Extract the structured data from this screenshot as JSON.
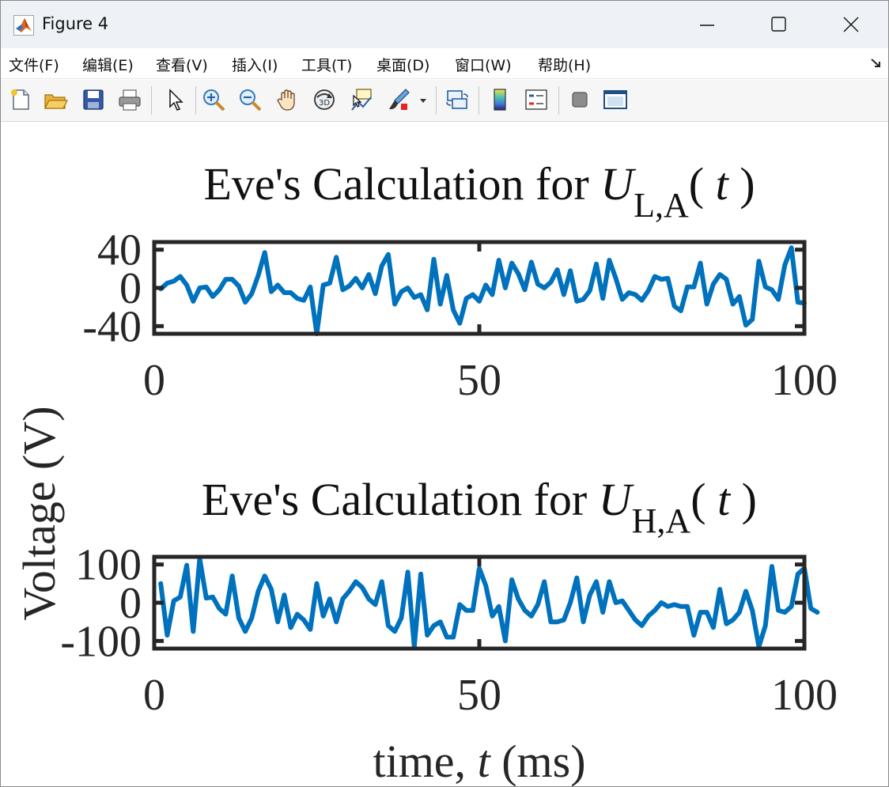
{
  "window": {
    "title": "Figure 4"
  },
  "menubar": {
    "items": [
      {
        "label": "文件(F)",
        "key": "file"
      },
      {
        "label": "编辑(E)",
        "key": "edit"
      },
      {
        "label": "查看(V)",
        "key": "view"
      },
      {
        "label": "插入(I)",
        "key": "insert"
      },
      {
        "label": "工具(T)",
        "key": "tools"
      },
      {
        "label": "桌面(D)",
        "key": "desktop"
      },
      {
        "label": "窗口(W)",
        "key": "window"
      },
      {
        "label": "帮助(H)",
        "key": "help"
      }
    ]
  },
  "toolbar": {
    "icons": [
      "new-figure-icon",
      "open-file-icon",
      "save-icon",
      "print-icon",
      "edit-plot-arrow-icon",
      "zoom-in-icon",
      "zoom-out-icon",
      "pan-hand-icon",
      "rotate-3d-icon",
      "data-cursor-icon",
      "brush-icon",
      "link-plot-icon",
      "colorbar-icon",
      "legend-icon",
      "hide-plot-tools-icon",
      "show-plot-tools-icon"
    ]
  },
  "figure": {
    "ylabel": "Voltage (V)",
    "xlabel": "time, ",
    "xlabel_var": "t",
    "xlabel_unit": " (ms)"
  },
  "chart_data": [
    {
      "type": "line",
      "title_prefix": "Eve's Calculation for ",
      "title_var": "U",
      "title_sub": "L,A",
      "title_suffix_open": "( ",
      "title_arg": "t",
      "title_suffix_close": " )",
      "xlim": [
        0,
        100
      ],
      "ylim": [
        -48,
        48
      ],
      "xticks": [
        "0",
        "50",
        "100"
      ],
      "yticks": [
        "40",
        "0",
        "-40"
      ],
      "series_color": "#0072BD",
      "x_start": 1,
      "x_step": 1,
      "values": [
        -1,
        5,
        7,
        12,
        3,
        -14,
        0,
        1,
        -9,
        -2,
        9,
        9,
        2,
        -15,
        -6,
        13,
        37,
        -4,
        3,
        -5,
        -5,
        -11,
        -13,
        1,
        -48,
        3,
        5,
        32,
        -2,
        2,
        10,
        0,
        14,
        -6,
        23,
        35,
        -17,
        -4,
        0,
        -10,
        -7,
        -23,
        30,
        -17,
        13,
        -23,
        -37,
        -11,
        -7,
        -14,
        3,
        -7,
        29,
        0,
        26,
        15,
        -2,
        27,
        4,
        0,
        6,
        19,
        -7,
        18,
        -14,
        -12,
        -3,
        25,
        -11,
        29,
        10,
        -12,
        -5,
        -7,
        -13,
        -3,
        12,
        9,
        10,
        -19,
        -24,
        1,
        1,
        26,
        -17,
        4,
        14,
        9,
        -17,
        -9,
        -39,
        -33,
        28,
        1,
        -2,
        -12,
        24,
        42,
        -15,
        -16
      ]
    },
    {
      "type": "line",
      "title_prefix": "Eve's Calculation for ",
      "title_var": "U",
      "title_sub": "H,A",
      "title_suffix_open": "( ",
      "title_arg": "t",
      "title_suffix_close": " )",
      "xlim": [
        0,
        100
      ],
      "ylim": [
        -120,
        120
      ],
      "xticks": [
        "0",
        "50",
        "100"
      ],
      "yticks": [
        "100",
        "0",
        "-100"
      ],
      "series_color": "#0072BD",
      "x_start": 1,
      "x_step": 1,
      "values": [
        50,
        -85,
        5,
        15,
        98,
        -75,
        115,
        12,
        15,
        -15,
        -30,
        70,
        -40,
        -75,
        -40,
        30,
        70,
        35,
        -50,
        20,
        -65,
        -30,
        -45,
        -70,
        50,
        -35,
        10,
        -50,
        10,
        30,
        55,
        40,
        10,
        -5,
        55,
        -60,
        -75,
        -40,
        80,
        -115,
        75,
        -85,
        -60,
        -50,
        -90,
        -90,
        -5,
        -20,
        -20,
        90,
        45,
        -35,
        -10,
        -100,
        60,
        10,
        -20,
        -35,
        -5,
        55,
        -50,
        -50,
        -45,
        0,
        65,
        -50,
        20,
        55,
        -25,
        55,
        0,
        5,
        -20,
        -45,
        -60,
        -35,
        -20,
        0,
        -10,
        -5,
        -10,
        -10,
        -85,
        -25,
        -25,
        -65,
        35,
        -55,
        -45,
        -25,
        30,
        -20,
        -115,
        -60,
        95,
        -20,
        -25,
        -10,
        75,
        90,
        -15,
        -25
      ]
    }
  ]
}
